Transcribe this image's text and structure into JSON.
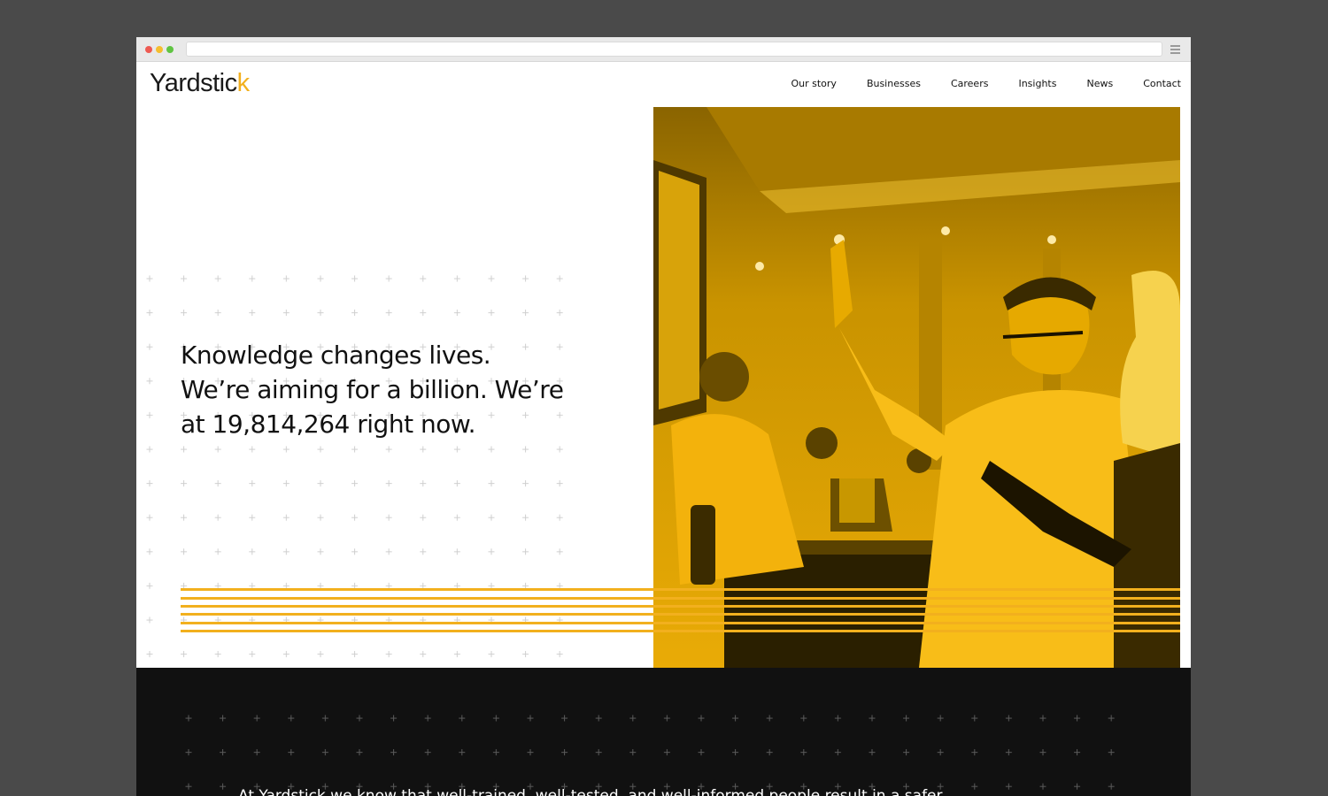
{
  "brand": {
    "logo_main": "Yardstic",
    "logo_accent": "k",
    "accent_color": "#f2b01e"
  },
  "nav": {
    "items": [
      "Our story",
      "Businesses",
      "Careers",
      "Insights",
      "News",
      "Contact"
    ]
  },
  "hero": {
    "lines": [
      "Knowledge changes lives.",
      "We’re aiming for a billion. We’re",
      "at 19,814,264 right now."
    ]
  },
  "dark_section": {
    "text": "At Yardstick we know that well-trained, well-tested, and well-informed people result in a safer"
  },
  "colors": {
    "dark_bg": "#111111",
    "photo_tint": "#f2b01e",
    "page_bg": "#4a4a4a"
  }
}
